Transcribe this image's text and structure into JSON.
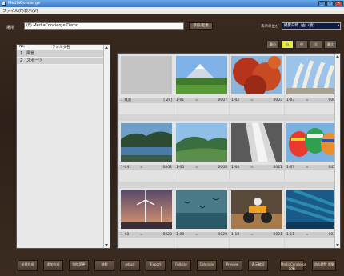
{
  "window": {
    "title": "MediaConcierge",
    "buttons": [
      "_",
      "□",
      "×"
    ]
  },
  "menu": [
    "ファイル(F)",
    "表示(V)"
  ],
  "toolbar": {
    "path_label": "場所",
    "path_value": "(F) MediaConcierge Demo",
    "path_button": "参照/変更",
    "sort_label": "表示の並び",
    "sort_value": "撮影日時（古い順）",
    "size_buttons": [
      "最小",
      "小",
      "中",
      "大",
      "最大"
    ],
    "active_size_index": 1
  },
  "folder_list": {
    "header": {
      "no": "No.",
      "name": "フォルダ名"
    },
    "rows": [
      {
        "no": "1",
        "name": "風景"
      },
      {
        "no": "2",
        "name": "スポーツ"
      }
    ]
  },
  "grid": {
    "folder_cell": {
      "name": "1 風景",
      "count": "[ 28]"
    },
    "cells": [
      {
        "index": "1-01",
        "sep": "=",
        "id": "0007",
        "icon": "mountain-field-photo",
        "colors": [
          "#7fb2e6",
          "#3f7a2e"
        ]
      },
      {
        "index": "1-02",
        "sep": "=",
        "id": "0003",
        "icon": "autumn-leaves-photo",
        "colors": [
          "#8ab4d8",
          "#b8331c"
        ]
      },
      {
        "index": "1-03",
        "sep": "=",
        "id": "0004",
        "icon": "pampas-grass-photo",
        "colors": [
          "#9cc4e8",
          "#e8e8e0"
        ]
      },
      {
        "index": "1-04",
        "sep": "=",
        "id": "0002",
        "icon": "lake-forest-photo",
        "colors": [
          "#6f9fc8",
          "#2d4a32"
        ]
      },
      {
        "index": "1-05",
        "sep": "=",
        "id": "0008",
        "icon": "hills-photo",
        "colors": [
          "#8fbfe6",
          "#3a6e3e"
        ]
      },
      {
        "index": "1-06",
        "sep": "=",
        "id": "0021",
        "icon": "waterfall-photo",
        "colors": [
          "#5a5a5a",
          "#d8d8d8"
        ]
      },
      {
        "index": "1-07",
        "sep": "=",
        "id": "0022",
        "icon": "balloons-photo",
        "colors": [
          "#7ab0e0",
          "#e83a2e"
        ]
      },
      {
        "index": "1-08",
        "sep": "=",
        "id": "0023",
        "icon": "wind-turbine-photo",
        "colors": [
          "#d88a6a",
          "#4a3a4a"
        ]
      },
      {
        "index": "1-09",
        "sep": "=",
        "id": "0029",
        "icon": "birds-sea-photo",
        "colors": [
          "#4a7a88",
          "#2a5a68"
        ]
      },
      {
        "index": "1-10",
        "sep": "=",
        "id": "0001",
        "icon": "motocross-photo",
        "colors": [
          "#5a4a3a",
          "#a87a4a"
        ]
      },
      {
        "index": "1-11",
        "sep": "=",
        "id": "0030",
        "icon": "underwater-photo",
        "colors": [
          "#1a5a8a",
          "#2a8ab0"
        ]
      }
    ]
  },
  "bottom_buttons": [
    "新規作成",
    "追加作成",
    "削除変更",
    "移動",
    "Adjust",
    "Export",
    "Fullsize",
    "Calendar",
    "Preview",
    "表示確認",
    "MediaConcierge 起動",
    "Web閲覧 起動"
  ]
}
